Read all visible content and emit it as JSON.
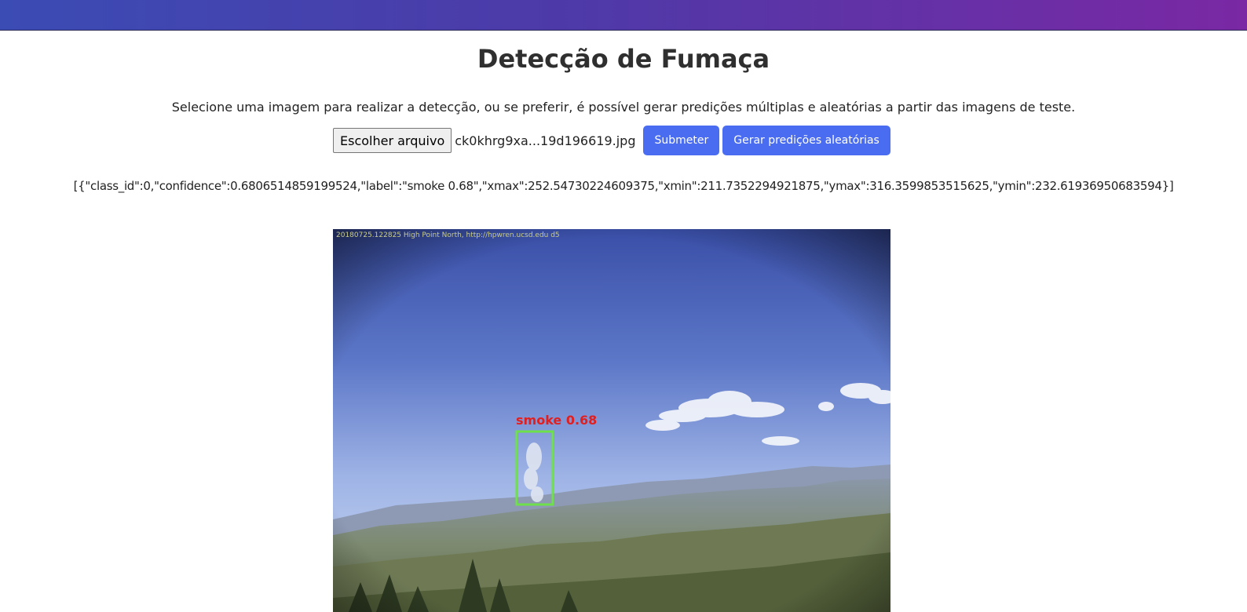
{
  "header": {
    "title": "Detecção de Fumaça",
    "description": "Selecione uma imagem para realizar a detecção, ou se preferir, é possível gerar predições múltiplas e aleatórias a partir das imagens de teste."
  },
  "form": {
    "file_button_label": "Escolher arquivo",
    "file_name": "ck0khrg9xa...19d196619.jpg",
    "submit_label": "Submeter",
    "random_label": "Gerar predições aleatórias"
  },
  "result": {
    "json_text": "[{\"class_id\":0,\"confidence\":0.6806514859199524,\"label\":\"smoke 0.68\",\"xmax\":252.54730224609375,\"xmin\":211.7352294921875,\"ymax\":316.3599853515625,\"ymin\":232.61936950683594}]"
  },
  "image": {
    "camera_caption": "20180725.122825  High  Point  North,  http://hpwren.ucsd.edu  d5",
    "detection_label": "smoke 0.68",
    "colors": {
      "box": "#6de04a",
      "label": "#e02020"
    }
  },
  "colors": {
    "primary_button": "#4a6cf0",
    "topbar_start": "#3b4cb4",
    "topbar_end": "#7a28a4"
  }
}
